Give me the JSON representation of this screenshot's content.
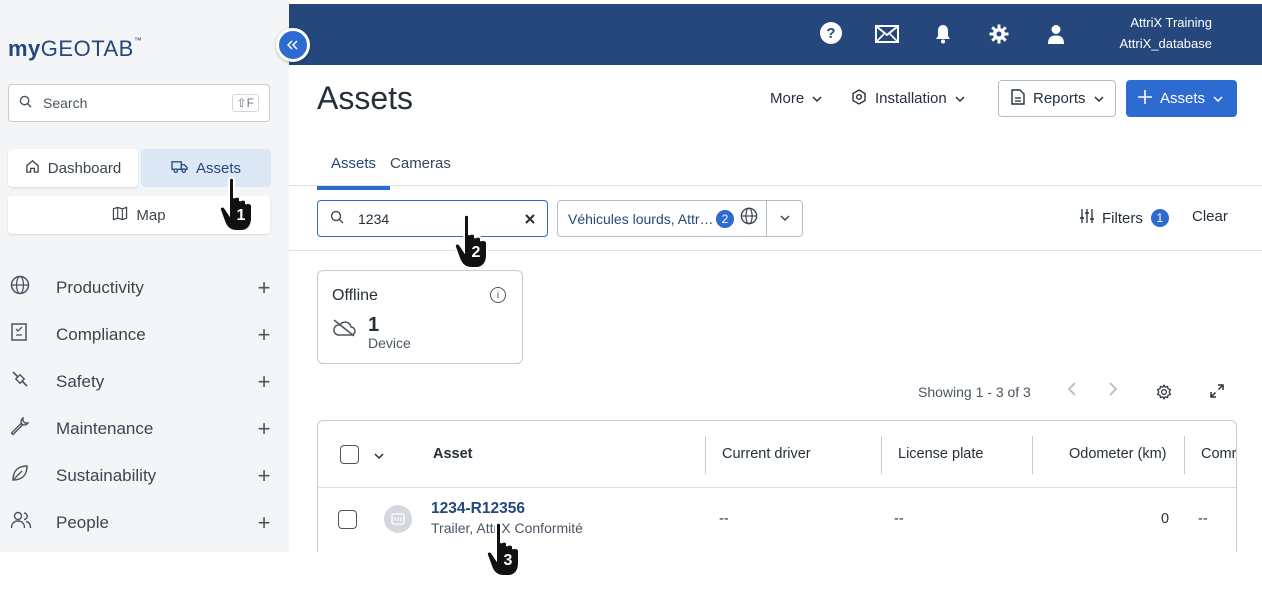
{
  "app": {
    "logo_bold": "my",
    "logo_text": "GEOTAB",
    "logo_tm": "™"
  },
  "sidebar": {
    "search_placeholder": "Search",
    "search_shortcut": "⇧F",
    "quick": {
      "dashboard": "Dashboard",
      "assets": "Assets",
      "map": "Map"
    },
    "nav": [
      {
        "label": "Productivity",
        "icon": "globe-icon"
      },
      {
        "label": "Compliance",
        "icon": "compliance-icon"
      },
      {
        "label": "Safety",
        "icon": "safety-icon"
      },
      {
        "label": "Maintenance",
        "icon": "wrench-icon"
      },
      {
        "label": "Sustainability",
        "icon": "leaf-icon"
      },
      {
        "label": "People",
        "icon": "people-icon"
      }
    ],
    "expand_symbol": "+"
  },
  "topbar": {
    "user_name": "AttriX Training",
    "database": "AttriX_database"
  },
  "header": {
    "title": "Assets",
    "more": "More",
    "installation": "Installation",
    "reports": "Reports",
    "add_assets": "Assets"
  },
  "tabs": [
    "Assets",
    "Cameras"
  ],
  "filter_bar": {
    "search_value": "1234",
    "group_text": "Véhicules lourds, Attr…",
    "group_count": "2",
    "filters_label": "Filters",
    "filters_count": "1",
    "clear_label": "Clear"
  },
  "status_card": {
    "title": "Offline",
    "count": "1",
    "unit": "Device"
  },
  "pager": {
    "text": "Showing 1 - 3 of 3"
  },
  "table": {
    "columns": [
      "Asset",
      "Current driver",
      "License plate",
      "Odometer (km)",
      "Comr"
    ],
    "rows": [
      {
        "name": "1234-R12356",
        "sub": "Trailer, AttriX Conformité",
        "driver": "--",
        "plate": "--",
        "odometer": "0",
        "comment": "--"
      }
    ]
  },
  "cursors": [
    "1",
    "2",
    "3"
  ],
  "colors": {
    "brand": "#25477b",
    "accent": "#2e6bd1"
  }
}
